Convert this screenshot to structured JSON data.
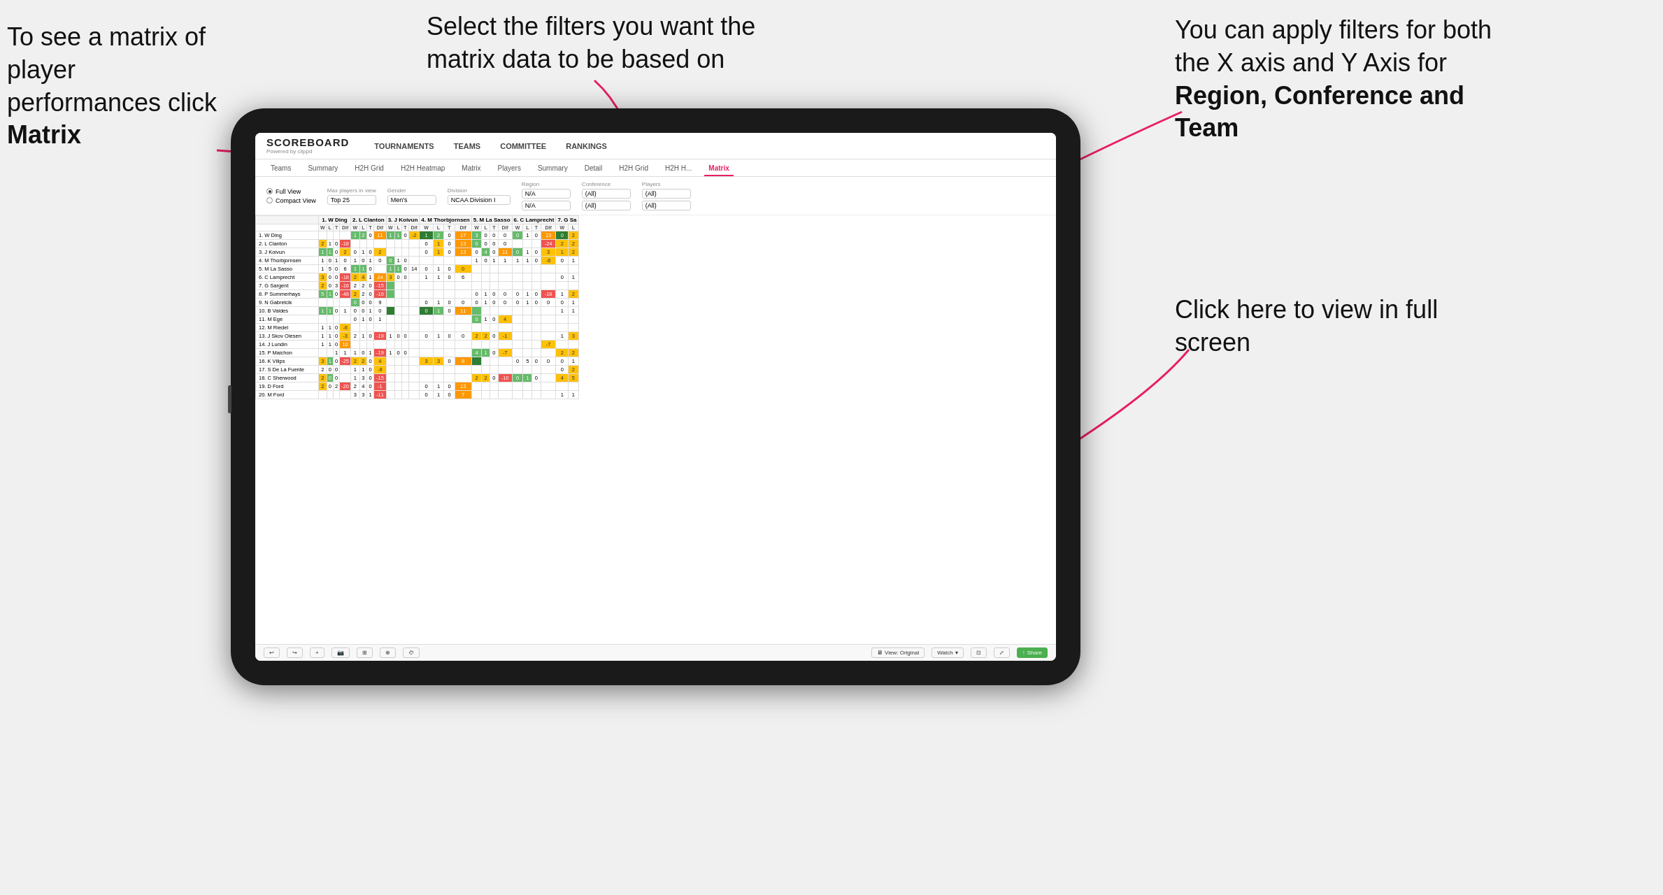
{
  "annotations": {
    "top_left": "To see a matrix of player performances click Matrix",
    "top_left_bold": "Matrix",
    "top_center": "Select the filters you want the matrix data to be based on",
    "top_right_line1": "You  can apply filters for both the X axis and Y Axis for ",
    "top_right_bold": "Region, Conference and Team",
    "bottom_right_line1": "Click here to view in full screen"
  },
  "app": {
    "logo_main": "SCOREBOARD",
    "logo_sub": "Powered by clippd",
    "nav_items": [
      "TOURNAMENTS",
      "TEAMS",
      "COMMITTEE",
      "RANKINGS"
    ]
  },
  "sub_nav": {
    "items": [
      {
        "label": "Teams",
        "active": false
      },
      {
        "label": "Summary",
        "active": false
      },
      {
        "label": "H2H Grid",
        "active": false
      },
      {
        "label": "H2H Heatmap",
        "active": false
      },
      {
        "label": "Matrix",
        "active": false
      },
      {
        "label": "Players",
        "active": false
      },
      {
        "label": "Summary",
        "active": false
      },
      {
        "label": "Detail",
        "active": false
      },
      {
        "label": "H2H Grid",
        "active": false
      },
      {
        "label": "H2H H...",
        "active": false
      },
      {
        "label": "Matrix",
        "active": true
      }
    ]
  },
  "filters": {
    "view_options": [
      "Full View",
      "Compact View"
    ],
    "max_players_label": "Max players in view",
    "max_players_value": "Top 25",
    "gender_label": "Gender",
    "gender_value": "Men's",
    "division_label": "Division",
    "division_value": "NCAA Division I",
    "region_label": "Region",
    "region_value1": "N/A",
    "region_value2": "N/A",
    "conference_label": "Conference",
    "conference_value1": "(All)",
    "conference_value2": "(All)",
    "players_label": "Players",
    "players_value1": "(All)",
    "players_value2": "(All)"
  },
  "matrix": {
    "col_headers": [
      "1. W Ding",
      "2. L Clanton",
      "3. J Koivun",
      "4. M Thorbjornsen",
      "5. M La Sasso",
      "6. C Lamprecht",
      "7. G Sa"
    ],
    "sub_headers": [
      "W",
      "L",
      "T",
      "Dif"
    ],
    "rows": [
      {
        "name": "1. W Ding"
      },
      {
        "name": "2. L Clanton"
      },
      {
        "name": "3. J Koivun"
      },
      {
        "name": "4. M Thorbjornsen"
      },
      {
        "name": "5. M La Sasso"
      },
      {
        "name": "6. C Lamprecht"
      },
      {
        "name": "7. G Sargent"
      },
      {
        "name": "8. P Summerhays"
      },
      {
        "name": "9. N Gabrelcik"
      },
      {
        "name": "10. B Valdes"
      },
      {
        "name": "11. M Ege"
      },
      {
        "name": "12. M Riedel"
      },
      {
        "name": "13. J Skov Olesen"
      },
      {
        "name": "14. J Lundin"
      },
      {
        "name": "15. P Maichon"
      },
      {
        "name": "16. K Vilips"
      },
      {
        "name": "17. S De La Fuente"
      },
      {
        "name": "18. C Sherwood"
      },
      {
        "name": "19. D Ford"
      },
      {
        "name": "20. M Ford"
      }
    ]
  },
  "bottom_bar": {
    "view_original": "View: Original",
    "watch": "Watch",
    "share": "Share",
    "icons": [
      "undo",
      "redo",
      "add",
      "screenshot",
      "grid",
      "settings",
      "timer",
      "view-original",
      "watch",
      "present",
      "expand",
      "share"
    ]
  }
}
